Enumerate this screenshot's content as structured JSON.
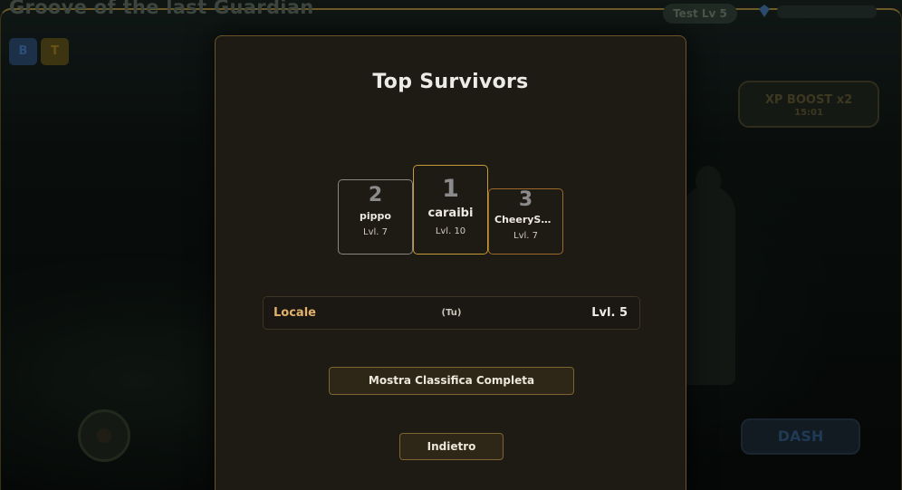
{
  "game": {
    "title": "Groove of the last Guardian",
    "pill_label": "Test Lv 5",
    "xp_boost": {
      "line1": "XP BOOST x2",
      "line2": "15:01"
    },
    "buttons": {
      "b": "B",
      "t": "T",
      "dash": "DASH"
    }
  },
  "leaderboard": {
    "title": "Top Survivors",
    "podium": [
      {
        "rank": "2",
        "name": "pippo",
        "level": "Lvl. 7"
      },
      {
        "rank": "1",
        "name": "caraibi",
        "level": "Lvl. 10"
      },
      {
        "rank": "3",
        "name": "CheerySe...",
        "level": "Lvl. 7"
      }
    ],
    "local": {
      "name": "Locale",
      "tag": "(Tu)",
      "level": "Lvl. 5"
    },
    "full_button": "Mostra Classifica Completa",
    "back_button": "Indietro"
  },
  "colors": {
    "gold_first": "#c49b38",
    "silver_second": "#8b8780",
    "bronze_third": "#9b6a2a",
    "local_name": "#e2b16c"
  }
}
